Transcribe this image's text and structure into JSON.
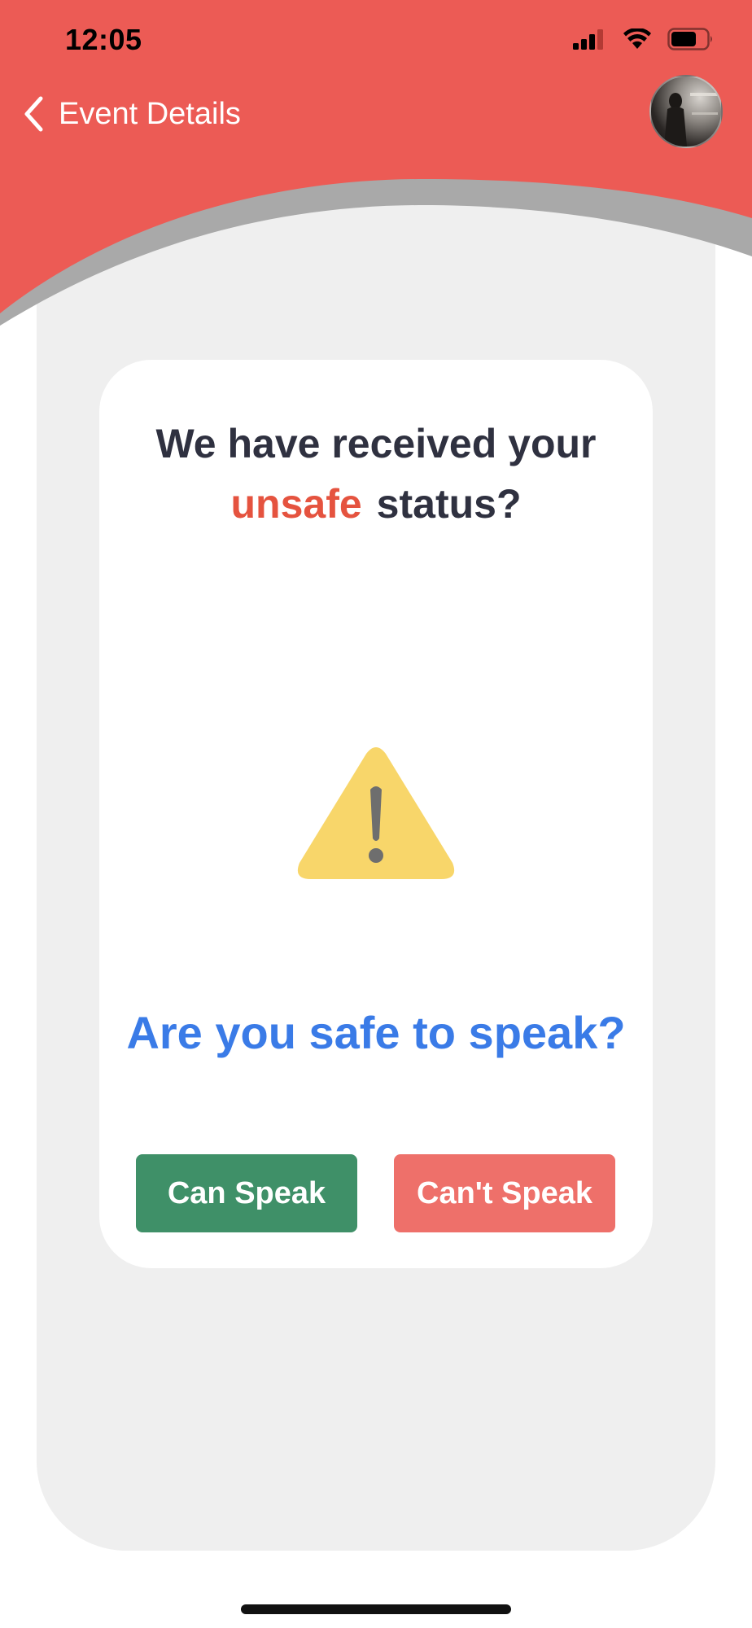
{
  "status_bar": {
    "time": "12:05"
  },
  "header": {
    "title": "Event Details",
    "back_icon": "chevron-left-icon",
    "avatar": "profile-avatar"
  },
  "card": {
    "heading_line1": "We have received your",
    "heading_highlight": "unsafe",
    "heading_end": "status?",
    "icon": "warning-icon",
    "question": "Are you safe to speak?",
    "buttons": {
      "can_speak": "Can Speak",
      "cant_speak": "Can't Speak"
    }
  },
  "colors": {
    "header_red": "#ec5b55",
    "highlight_red": "#e5533f",
    "question_blue": "#3a7be7",
    "can_speak_green": "#3f9068",
    "cant_speak_red": "#ee706a",
    "warning_yellow": "#f8d66a"
  }
}
